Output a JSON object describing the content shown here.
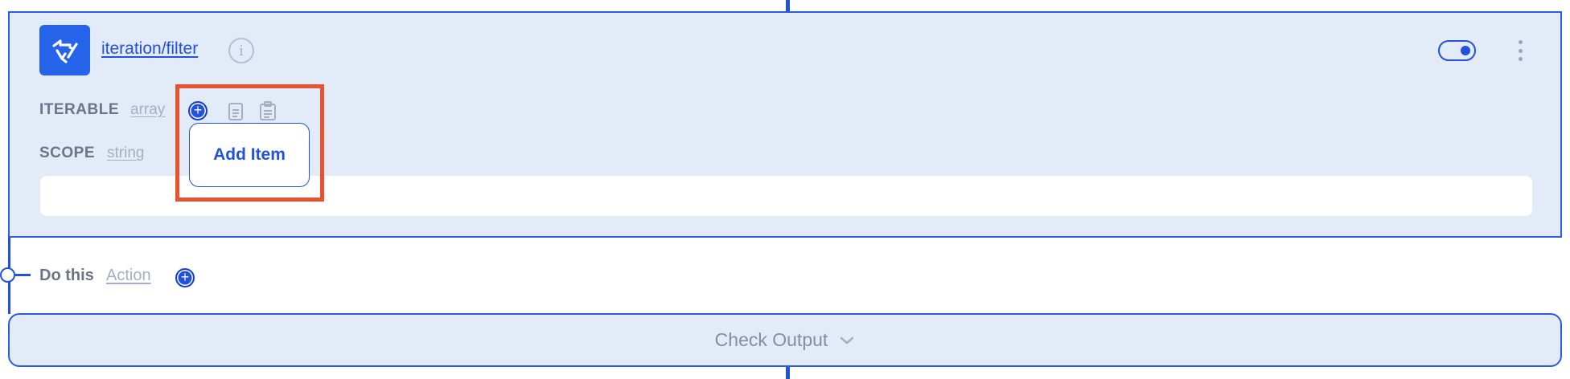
{
  "node": {
    "title": "iteration/filter",
    "info_symbol": "i",
    "enabled": true,
    "params": [
      {
        "label": "ITERABLE",
        "type": "array"
      },
      {
        "label": "SCOPE",
        "type": "string"
      }
    ],
    "scope_value": ""
  },
  "tooltip": {
    "text": "Add Item"
  },
  "do_this": {
    "label": "Do this",
    "type": "Action"
  },
  "check_output": {
    "label": "Check Output"
  },
  "colors": {
    "accent": "#2152dd",
    "card_bg": "#e3eaf8",
    "highlight": "#e8532f"
  },
  "icons": [
    "shuffle-arrows-icon",
    "info-icon",
    "toggle-switch",
    "kebab-menu-icon",
    "add-circle-icon",
    "copy-icon",
    "paste-icon",
    "chevron-down-icon"
  ]
}
